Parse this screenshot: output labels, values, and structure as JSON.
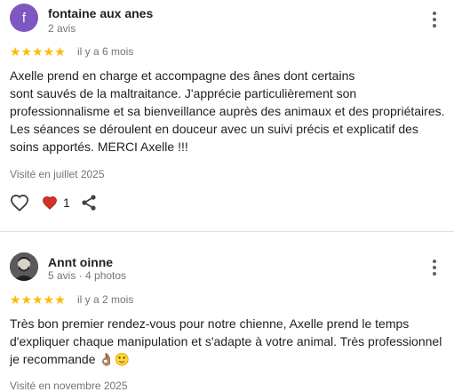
{
  "reviews": [
    {
      "avatar_letter": "f",
      "author": "fontaine aux anes",
      "meta": "2 avis",
      "rating": 5,
      "stars": "★★★★★",
      "time": "il y a 6 mois",
      "text_lines": [
        "Axelle prend en charge et accompagne des ânes dont certains",
        "sont sauvés de la maltraitance. J'apprécie particulièrement son",
        "professionnalisme et sa bienveillance auprès des animaux et des propriétaires.",
        "Les séances se déroulent en douceur avec un suivi précis et explicatif des",
        "soins apportés. MERCI Axelle !!!"
      ],
      "visited": "Visité en juillet 2025",
      "like_count": "1"
    },
    {
      "author": "Annt oinne",
      "meta": "5 avis · 4 photos",
      "rating": 5,
      "stars": "★★★★★",
      "time": "il y a 2 mois",
      "text_lines": [
        "Très bon premier rendez-vous pour notre chienne, Axelle prend le temps",
        "d'expliquer chaque manipulation et s'adapte à votre animal. Très professionnel",
        "je recommande 👌🏽🙂"
      ],
      "visited": "Visité en novembre 2025"
    }
  ],
  "colors": {
    "star": "#fbbc04",
    "avatar_purple": "#7e57c2",
    "heart_red": "#d93025",
    "muted_text": "#70757a"
  },
  "icons": [
    "more-vert-icon",
    "star-icon",
    "heart-outline-icon",
    "heart-filled-icon",
    "share-icon"
  ]
}
